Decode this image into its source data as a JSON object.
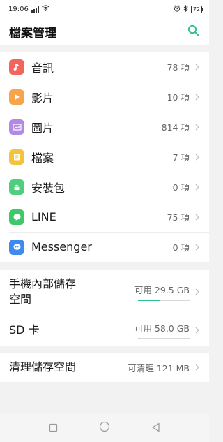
{
  "status_bar": {
    "time": "19:06",
    "signal_text": ".ıl",
    "battery": "72",
    "icons": [
      "signal-icon",
      "wifi-icon",
      "alarm-icon",
      "bluetooth-icon",
      "battery-icon"
    ]
  },
  "header": {
    "title": "檔案管理",
    "search_icon": "search-icon"
  },
  "categories": [
    {
      "label": "音訊",
      "count": "78 項",
      "icon": "music-note-icon",
      "color": "#f2645c"
    },
    {
      "label": "影片",
      "count": "10 項",
      "icon": "play-icon",
      "color": "#f7a44a"
    },
    {
      "label": "圖片",
      "count": "814 項",
      "icon": "image-icon",
      "color": "#b28ae6"
    },
    {
      "label": "檔案",
      "count": "7 項",
      "icon": "document-icon",
      "color": "#f2c33c"
    },
    {
      "label": "安裝包",
      "count": "0 項",
      "icon": "android-icon",
      "color": "#4fcf7d"
    },
    {
      "label": "LINE",
      "count": "75 項",
      "icon": "line-chat-icon",
      "color": "#3dc96a"
    },
    {
      "label": "Messenger",
      "count": "0 項",
      "icon": "messenger-icon",
      "color": "#3d8bef"
    }
  ],
  "storage": {
    "internal": {
      "label_line1": "手機內部儲存",
      "label_line2": "空間",
      "available": "可用 29.5 GB",
      "used_fraction": 0.42,
      "bar_color": "#2fbf8f"
    },
    "sd": {
      "label": "SD 卡",
      "available": "可用 58.0 GB",
      "used_fraction": 0.02,
      "bar_color": "#c8c8c8"
    }
  },
  "cleanup": {
    "label": "清理儲存空間",
    "value": "可清理 121 MB"
  },
  "nav": {
    "icons": [
      "recents-square-icon",
      "home-circle-icon",
      "back-triangle-icon"
    ]
  },
  "colors": {
    "accent": "#2fbf8f",
    "chevron": "#c2c2c2"
  }
}
